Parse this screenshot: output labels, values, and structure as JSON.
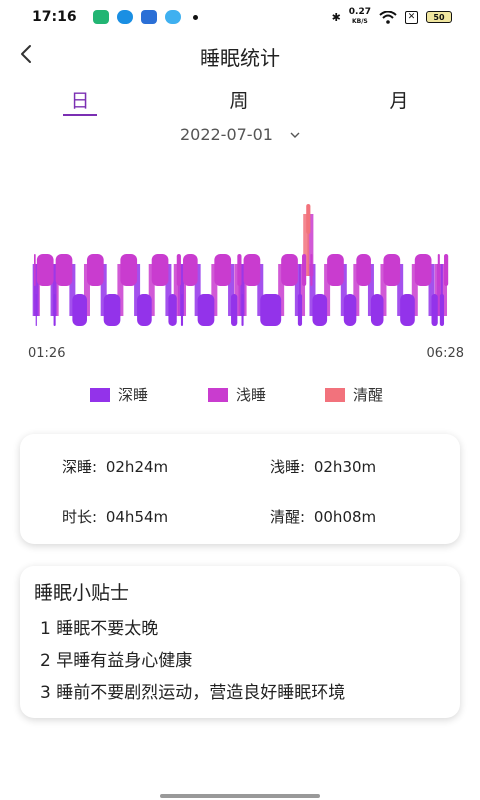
{
  "status_bar": {
    "time": "17:16",
    "net_speed_value": "0.27",
    "net_speed_unit": "KB/S",
    "battery": "50"
  },
  "header": {
    "title": "睡眠统计"
  },
  "tabs": [
    {
      "label": "日",
      "active": true
    },
    {
      "label": "周",
      "active": false
    },
    {
      "label": "月",
      "active": false
    }
  ],
  "date_picker": {
    "value": "2022-07-01"
  },
  "chart_data": {
    "type": "bar",
    "x_start_label": "01:26",
    "x_end_label": "06:28",
    "levels": [
      "深睡",
      "浅睡",
      "清醒"
    ],
    "segments": [
      [
        "浅睡",
        0.4
      ],
      [
        "深睡",
        0.0
      ],
      [
        "浅睡",
        4.0
      ],
      [
        "深睡",
        0.5
      ],
      [
        "浅睡",
        4.0
      ],
      [
        "深睡",
        3.5
      ],
      [
        "浅睡",
        4.0
      ],
      [
        "深睡",
        4.0
      ],
      [
        "浅睡",
        4.0
      ],
      [
        "深睡",
        3.5
      ],
      [
        "浅睡",
        4.0
      ],
      [
        "深睡",
        2.0
      ],
      [
        "浅睡",
        1.0
      ],
      [
        "深睡",
        0.5
      ],
      [
        "浅睡",
        3.5
      ],
      [
        "深睡",
        4.0
      ],
      [
        "浅睡",
        4.0
      ],
      [
        "深睡",
        1.5
      ],
      [
        "浅睡",
        1.0
      ],
      [
        "深睡",
        0.5
      ],
      [
        "浅睡",
        4.0
      ],
      [
        "深睡",
        5.0
      ],
      [
        "浅睡",
        4.0
      ],
      [
        "深睡",
        1.0
      ],
      [
        "浅睡",
        1.0
      ],
      [
        "清醒",
        1.0
      ],
      [
        "浅睡",
        0.5
      ],
      [
        "深睡",
        3.5
      ],
      [
        "浅睡",
        4.0
      ],
      [
        "深睡",
        3.0
      ],
      [
        "浅睡",
        3.5
      ],
      [
        "深睡",
        3.0
      ],
      [
        "浅睡",
        4.0
      ],
      [
        "深睡",
        3.5
      ],
      [
        "浅睡",
        4.0
      ],
      [
        "深睡",
        1.5
      ],
      [
        "浅睡",
        0.5
      ],
      [
        "深睡",
        1.0
      ],
      [
        "浅睡",
        1.0
      ]
    ]
  },
  "legend": [
    {
      "label": "深睡",
      "color": "#9333ea"
    },
    {
      "label": "浅睡",
      "color": "#c93ccf"
    },
    {
      "label": "清醒",
      "color": "#f2727c"
    }
  ],
  "stats": {
    "deep_label": "深睡:",
    "deep_value": "02h24m",
    "light_label": "浅睡:",
    "light_value": "02h30m",
    "duration_label": "时长:",
    "duration_value": "04h54m",
    "awake_label": "清醒:",
    "awake_value": "00h08m"
  },
  "tips": {
    "title": "睡眠小贴士",
    "items": [
      "1 睡眠不要太晚",
      "2 早睡有益身心健康",
      "3 睡前不要剧烈运动，营造良好睡眠环境"
    ]
  }
}
